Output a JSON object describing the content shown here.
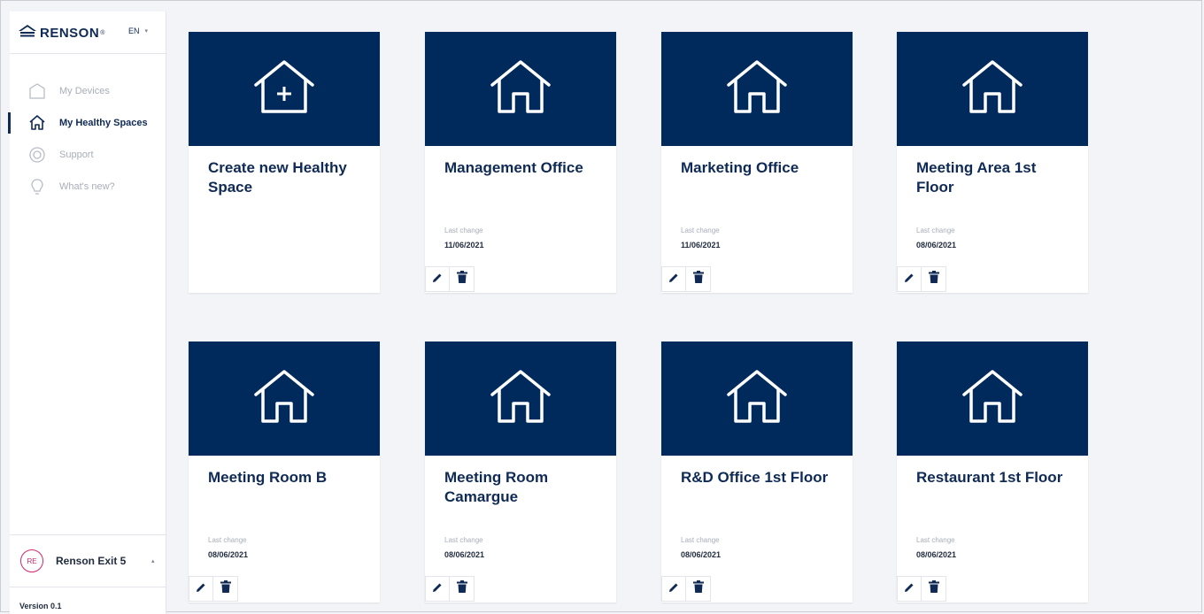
{
  "brand": {
    "name": "RENSON",
    "reg_mark": "®"
  },
  "language": {
    "selected": "EN"
  },
  "nav": [
    {
      "label": "My Devices",
      "icon": "device-icon",
      "active": false
    },
    {
      "label": "My Healthy Spaces",
      "icon": "home-icon",
      "active": true
    },
    {
      "label": "Support",
      "icon": "lifebuoy-icon",
      "active": false
    },
    {
      "label": "What's new?",
      "icon": "lightbulb-icon",
      "active": false
    }
  ],
  "account": {
    "initials": "RE",
    "name": "Renson Exit 5"
  },
  "version": "Version 0.1",
  "create_card": {
    "title": "Create new Healthy Space",
    "icon": "home-plus-icon"
  },
  "spaces_label": "Last change",
  "spaces": [
    {
      "name": "Management Office",
      "last_change": "11/06/2021"
    },
    {
      "name": "Marketing Office",
      "last_change": "11/06/2021"
    },
    {
      "name": "Meeting Area 1st Floor",
      "last_change": "08/06/2021"
    },
    {
      "name": "Meeting Room B",
      "last_change": "08/06/2021"
    },
    {
      "name": "Meeting Room Camargue",
      "last_change": "08/06/2021"
    },
    {
      "name": "R&D Office 1st Floor",
      "last_change": "08/06/2021"
    },
    {
      "name": "Restaurant 1st Floor",
      "last_change": "08/06/2021"
    }
  ],
  "colors": {
    "navy": "#002a5c",
    "text": "#0f2a55",
    "muted": "#a8adb8",
    "accent": "#d1286f",
    "background": "#f3f4f7"
  }
}
